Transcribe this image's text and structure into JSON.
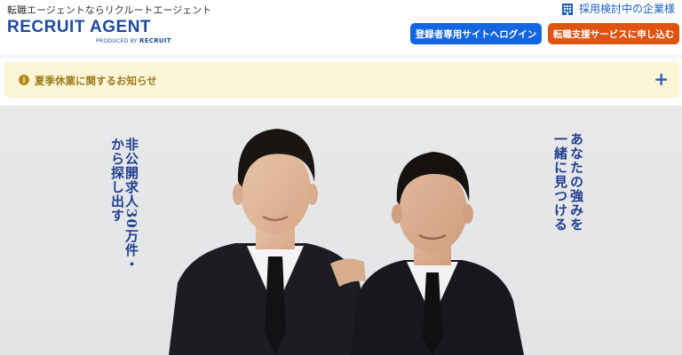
{
  "header": {
    "tagline": "転職エージェントならリクルートエージェント",
    "logo_text": "RECRUIT AGENT",
    "logo_sub": "PRODUCED BY",
    "logo_sub_brand": "RECRUIT",
    "corp_link": "採用検討中の企業様",
    "login_button": "登録者専用サイトへログイン",
    "apply_button": "転職支援サービスに申し込む"
  },
  "notice": {
    "text": "夏季休業に関するお知らせ",
    "expand": "+"
  },
  "hero": {
    "copy_left_line1": "非公開求人30万件・",
    "copy_left_line2": "から探し出す",
    "copy_right_line1": "あなたの強みを",
    "copy_right_line2": "一緒に見つける"
  },
  "colors": {
    "brand_blue": "#1f4aa0",
    "login_blue": "#1266e0",
    "apply_orange": "#e0520f",
    "notice_bg": "#fdf6d6"
  },
  "icons": [
    "building-icon",
    "info-icon",
    "plus-icon"
  ]
}
